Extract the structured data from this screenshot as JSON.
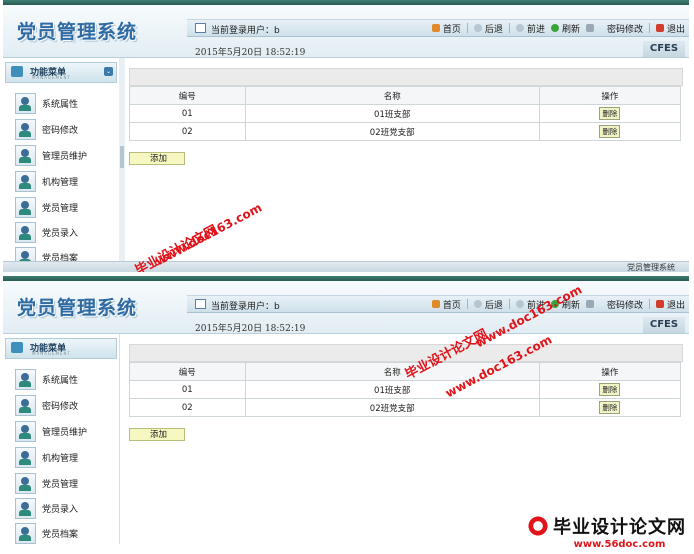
{
  "app": {
    "title": "党员管理系统",
    "brand": "CFES"
  },
  "header": {
    "user_label": "当前登录用户：b",
    "date": "2015年5月20日 18:52:19"
  },
  "nav": [
    {
      "label": "首页",
      "icon": "home-icon"
    },
    {
      "label": "后退",
      "icon": "back-icon"
    },
    {
      "label": "前进",
      "icon": "forward-icon"
    },
    {
      "label": "刷新",
      "icon": "refresh-icon"
    },
    {
      "label": "密码修改",
      "icon": "key-icon"
    },
    {
      "label": "退出",
      "icon": "exit-icon"
    }
  ],
  "sidebar": {
    "title": "功能菜单",
    "subtitle": "MANAGEMENT",
    "items": [
      {
        "label": "系统属性"
      },
      {
        "label": "密码修改"
      },
      {
        "label": "管理员维护"
      },
      {
        "label": "机构管理"
      },
      {
        "label": "党员管理"
      },
      {
        "label": "党员录入"
      },
      {
        "label": "党员档案"
      }
    ]
  },
  "table": {
    "headers": [
      "编号",
      "名称",
      "操作"
    ],
    "rows": [
      {
        "id": "01",
        "name": "01班支部",
        "action": "删除"
      },
      {
        "id": "02",
        "name": "02班党支部",
        "action": "删除"
      }
    ]
  },
  "add_label": "添加",
  "status_text": "党员管理系统",
  "watermark": {
    "site": "www.doc163.com",
    "cn": "毕业设计论文网",
    "bottom_cn": "毕业设计论文网",
    "bottom_site": "www.56doc.com"
  },
  "colors": {
    "logo": "#2f6ba3",
    "watermark": "#e0141a",
    "add_button": "#f7f8c1",
    "delete_button": "#f2f4c6"
  }
}
